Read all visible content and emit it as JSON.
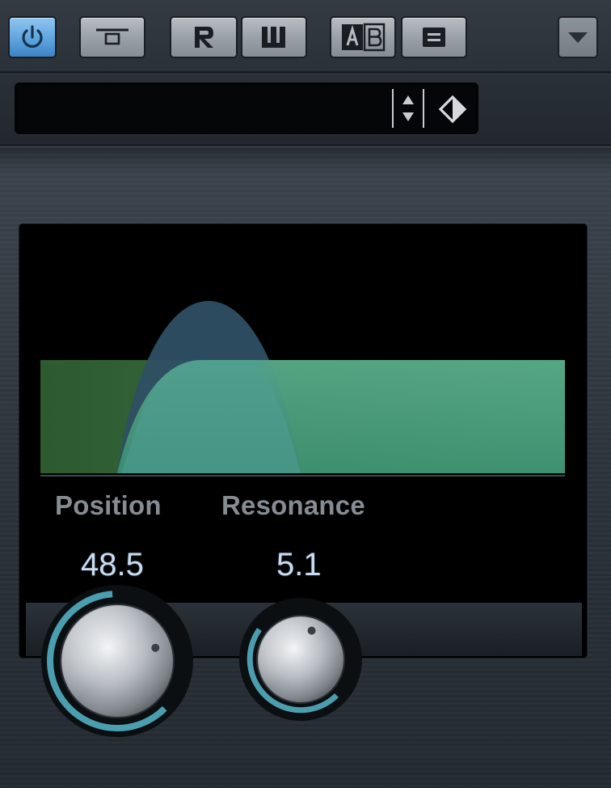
{
  "toolbar": {
    "buttons": [
      {
        "id": "power",
        "icon": "power-icon",
        "active": true
      },
      {
        "id": "bypass",
        "icon": "bypass-icon",
        "active": false
      },
      {
        "id": "read",
        "icon": "read-automation-icon",
        "active": false
      },
      {
        "id": "write",
        "icon": "write-automation-icon",
        "active": false
      },
      {
        "id": "ab",
        "icon": "ab-compare-icon",
        "active": false
      },
      {
        "id": "settings",
        "icon": "settings-icon",
        "active": false
      }
    ],
    "menu_icon": "chevron-down-icon",
    "accent_color": "#5aa1dc"
  },
  "preset": {
    "name": "",
    "browse_icon": "up-down-arrows-icon",
    "load_icon": "preset-diamond-icon"
  },
  "filter": {
    "fill_color": "#3a7a4c",
    "curve_color": "#4fa587",
    "peak_color": "#2e4f63"
  },
  "params": [
    {
      "label": "Position",
      "value": "48.5",
      "normalized": 0.485
    },
    {
      "label": "Resonance",
      "value": "5.1",
      "normalized": 0.3
    }
  ],
  "knob_ring_color": "#4a9eb0"
}
